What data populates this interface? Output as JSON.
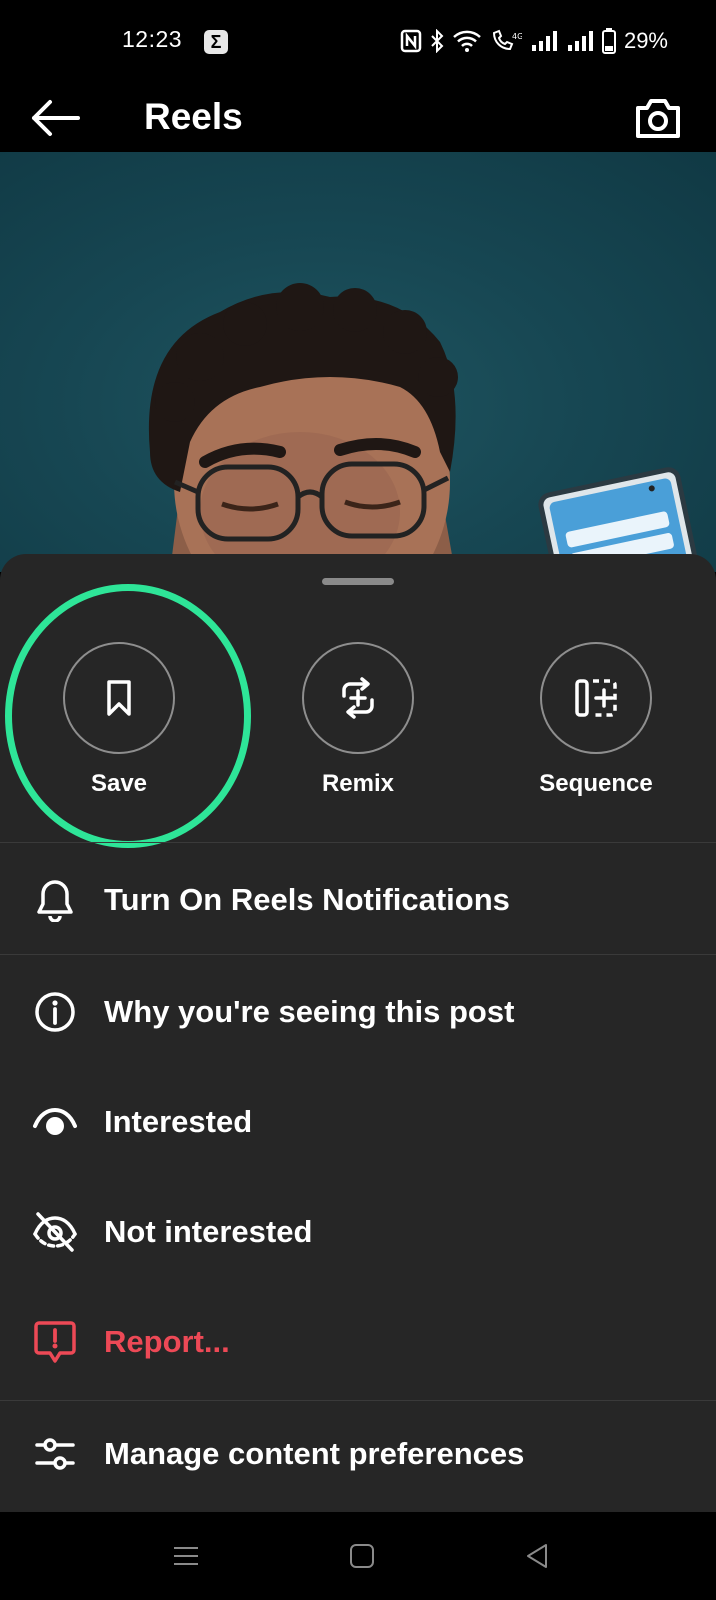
{
  "status_bar": {
    "time": "12:23",
    "app_icon_glyph": "Σ",
    "battery_text": "29%",
    "icons": [
      "nfc-icon",
      "bluetooth-icon",
      "wifi-icon",
      "volte-call-icon",
      "signal-icon",
      "signal-icon",
      "battery-icon"
    ]
  },
  "top_bar": {
    "title": "Reels",
    "back_icon": "arrow-left-icon",
    "camera_icon": "camera-icon"
  },
  "sheet": {
    "actions": [
      {
        "label": "Save",
        "icon": "bookmark-icon",
        "highlighted": true
      },
      {
        "label": "Remix",
        "icon": "remix-icon",
        "highlighted": false
      },
      {
        "label": "Sequence",
        "icon": "sequence-icon",
        "highlighted": false
      }
    ],
    "menu": [
      {
        "label": "Turn On Reels Notifications",
        "icon": "bell-icon"
      },
      {
        "label": "Why you're seeing this post",
        "icon": "info-icon"
      },
      {
        "label": "Interested",
        "icon": "eye-icon"
      },
      {
        "label": "Not interested",
        "icon": "eye-off-icon"
      },
      {
        "label": "Report...",
        "icon": "report-icon",
        "danger": true
      },
      {
        "label": "Manage content preferences",
        "icon": "sliders-icon"
      }
    ]
  },
  "colors": {
    "sheet_background": "#262626",
    "highlight_ring": "#2ee598",
    "danger": "#ed4956"
  },
  "nav_bar": {
    "buttons": [
      "menu-nav-icon",
      "home-nav-icon",
      "back-nav-icon"
    ]
  }
}
